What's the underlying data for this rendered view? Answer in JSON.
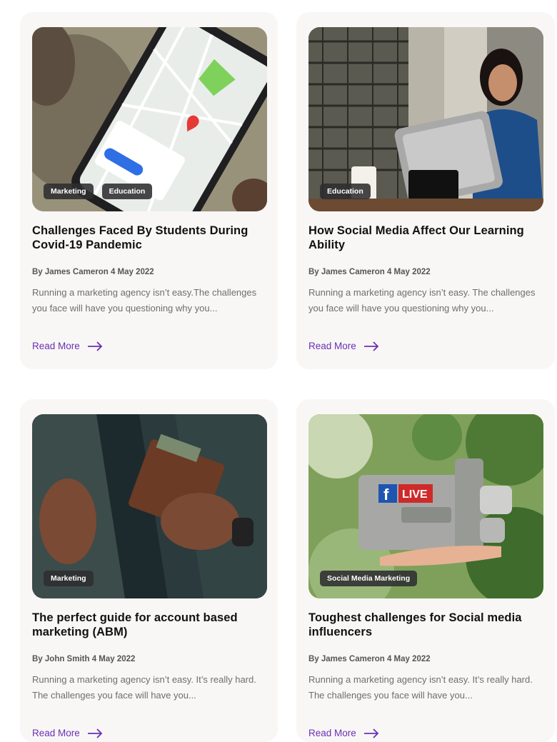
{
  "accent_color": "#6a2fb8",
  "read_more_label": "Read More",
  "cards": [
    {
      "title": "Challenges Faced By Students During Covid-19 Pandemic",
      "meta": "By James Cameron 4 May 2022",
      "excerpt": "Running a marketing agency isn’t easy.The challenges you face will have you questioning why you...",
      "tags": [
        "Marketing",
        "Education"
      ],
      "image": "hand-holding-phone-map"
    },
    {
      "title": "How Social Media Affect Our Learning Ability",
      "meta": "By James Cameron 4 May 2022",
      "excerpt": "Running a marketing agency isn’t easy. The challenges you face will have you questioning why you...",
      "tags": [
        "Education"
      ],
      "image": "woman-with-pos-terminal"
    },
    {
      "title": "The perfect guide for account based marketing (ABM)",
      "meta": "By John Smith 4 May 2022",
      "excerpt": "Running a marketing agency isn’t easy. It’s really hard. The challenges you face will have you...",
      "tags": [
        "Marketing"
      ],
      "image": "man-with-wallet"
    },
    {
      "title": "Toughest challenges for Social media influencers",
      "meta": "By James Cameron 4 May 2022",
      "excerpt": "Running a marketing agency isn’t easy. It’s really hard. The challenges you face will have you...",
      "tags": [
        "Social Media Marketing"
      ],
      "image": "camera-with-facebook-live"
    }
  ],
  "image_text": {
    "live_badge": "LIVE",
    "facebook_letter": "f"
  }
}
